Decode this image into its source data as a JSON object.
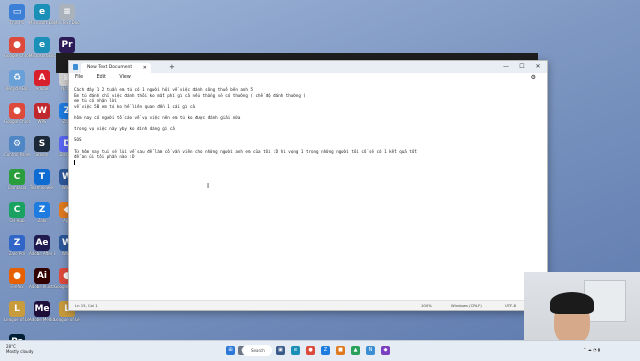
{
  "desktop": {
    "icons": [
      {
        "label": "This PC",
        "glyph": "▭",
        "color": "#3b7fd6"
      },
      {
        "label": "Microsoft Edge",
        "glyph": "e",
        "color": "#1a8fb8"
      },
      {
        "label": "Mới Text Document",
        "glyph": "≡",
        "color": "#aab2bc"
      },
      {
        "label": "Google Chrome",
        "glyph": "●",
        "color": "#dd4a3c"
      },
      {
        "label": "Microsoft Edge",
        "glyph": "e",
        "color": "#1a8fb8"
      },
      {
        "label": "Premiere",
        "glyph": "Pr",
        "color": "#2b1a55"
      },
      {
        "label": "Recycle Bin",
        "glyph": "♻",
        "color": "#6aa0d8"
      },
      {
        "label": "Adobe",
        "glyph": "A",
        "color": "#d8202c"
      },
      {
        "label": "Notes",
        "glyph": "≡",
        "color": "#d0d0d0"
      },
      {
        "label": "Google Chrome",
        "glyph": "●",
        "color": "#dd4a3c"
      },
      {
        "label": "WPS",
        "glyph": "W",
        "color": "#c0282d"
      },
      {
        "label": "Zalo",
        "glyph": "Z",
        "color": "#1e7be0"
      },
      {
        "label": "Control Panel",
        "glyph": "⚙",
        "color": "#4f86c6"
      },
      {
        "label": "Steam",
        "glyph": "S",
        "color": "#1b2838"
      },
      {
        "label": "Discord",
        "glyph": "D",
        "color": "#5865f2"
      },
      {
        "label": "Camtasia",
        "glyph": "C",
        "color": "#2a9d3c"
      },
      {
        "label": "TeamViewer",
        "glyph": "T",
        "color": "#0e6bd1"
      },
      {
        "label": "Word",
        "glyph": "W",
        "color": "#2b579a"
      },
      {
        "label": "CH Hub",
        "glyph": "C",
        "color": "#1aa260"
      },
      {
        "label": "Zalo",
        "glyph": "Z",
        "color": "#1e7be0"
      },
      {
        "label": "App",
        "glyph": "◆",
        "color": "#e07a1e"
      },
      {
        "label": "Zalo Pro",
        "glyph": "Z",
        "color": "#3066c8"
      },
      {
        "label": "Adobe After Effects",
        "glyph": "Ae",
        "color": "#1f1a4f"
      },
      {
        "label": "Word",
        "glyph": "W",
        "color": "#2b579a"
      },
      {
        "label": "Firefox",
        "glyph": "●",
        "color": "#e66000"
      },
      {
        "label": "Adobe Illustrator",
        "glyph": "Ai",
        "color": "#330000"
      },
      {
        "label": "Google Chrome",
        "glyph": "●",
        "color": "#dd4a3c"
      },
      {
        "label": "League of Legends",
        "glyph": "L",
        "color": "#c89b3c"
      },
      {
        "label": "Adobe Media Encoder",
        "glyph": "Me",
        "color": "#1f0d3a"
      },
      {
        "label": "League of Legends",
        "glyph": "L",
        "color": "#c89b3c"
      },
      {
        "label": "Adobe Photoshop",
        "glyph": "Ps",
        "color": "#001e36"
      }
    ]
  },
  "notepad": {
    "tab_title": "New Text Document",
    "tab_close": "✕",
    "new_tab": "+",
    "window_controls": {
      "minimize": "—",
      "maximize": "☐",
      "close": "✕"
    },
    "menu": {
      "file": "File",
      "edit": "Edit",
      "view": "View"
    },
    "settings_icon": "⚙",
    "lines": [
      "Cách đây 1 2 tuần em tú có 1 người hỏi về việc đánh sông thuê bên anh 5",
      "Em tú đánh chỉ việc đánh thôi ko mất phí gì cả nếu thắng sẽ có thưởng ( chế độ đánh thường )",
      "em tú có nhận lời",
      "về việc 5B em tú ko hề liên quan đến 1 cái gì cả",
      "",
      "hôm nay có người tố cáo về vụ việc nên em tú ko được đánh giải nữa",
      "",
      "trong vụ việc này yby ko dính dáng gì cả",
      "",
      "SOS",
      "",
      "Từ hôm nay tui sẽ lùi về sau để làm cố vấn viên cho những người anh em của tôi :D hi vọng 1 trong những người tôi cố sẽ có 1 kết quả tốt",
      "để an ủi tôi phần nào :D",
      ""
    ],
    "status": {
      "position": "Ln 15, Col 1",
      "zoom": "100%",
      "line_ending": "Windows (CRLF)",
      "encoding": "UTF-8"
    }
  },
  "taskbar": {
    "weather_temp": "28°C",
    "weather_desc": "Mostly cloudy",
    "search_label": "Search",
    "tray_time": "",
    "apps": [
      {
        "glyph": "⊞",
        "color": "#2b78d8"
      },
      {
        "glyph": "⌕",
        "color": "#6b7785"
      },
      {
        "glyph": "▣",
        "color": "#3a5a8a"
      },
      {
        "glyph": "e",
        "color": "#1a8fb8"
      },
      {
        "glyph": "●",
        "color": "#dd4a3c"
      },
      {
        "glyph": "Z",
        "color": "#1e7be0"
      },
      {
        "glyph": "■",
        "color": "#e07a1e"
      },
      {
        "glyph": "▲",
        "color": "#2aa15a"
      },
      {
        "glyph": "N",
        "color": "#3b8ed3"
      },
      {
        "glyph": "◆",
        "color": "#7b3fbf"
      }
    ]
  }
}
